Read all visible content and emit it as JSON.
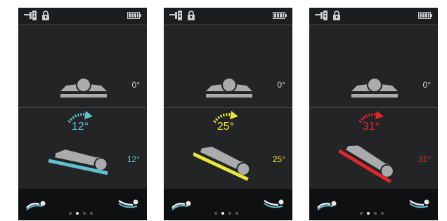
{
  "screens": [
    {
      "top_angle": "0°",
      "bottom_angle": "12°",
      "big_angle": "12°",
      "accent_color": "#5ec3cf",
      "tilt_degrees": 12,
      "active_page": 2,
      "page_count": 4
    },
    {
      "top_angle": "0°",
      "bottom_angle": "25°",
      "big_angle": "25°",
      "accent_color": "#e9e53a",
      "tilt_degrees": 25,
      "active_page": 2,
      "page_count": 4
    },
    {
      "top_angle": "0°",
      "bottom_angle": "31°",
      "big_angle": "31°",
      "accent_color": "#e5262b",
      "tilt_degrees": 31,
      "active_page": 2,
      "page_count": 4
    }
  ],
  "icons": {
    "plug": "plug-icon",
    "lock": "lock-icon",
    "battery": "battery-icon",
    "flat_mode": "flat-position-icon",
    "tilt_mode": "tilt-position-icon"
  },
  "colors": {
    "screen_bg": "#222425",
    "figure_gray": "#a9abac",
    "text_light": "#cfd2d3"
  }
}
